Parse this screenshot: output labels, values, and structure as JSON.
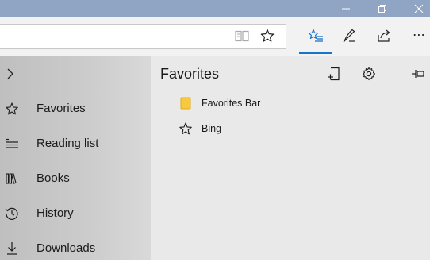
{
  "window": {
    "minimize_label": "Minimize",
    "restore_label": "Restore",
    "close_label": "Close"
  },
  "toolbar": {
    "address_value": "",
    "reading_view_icon": "book-open-icon",
    "add_favorite_icon": "star-outline-icon",
    "hub_icon": "favorites-hub-icon",
    "notes_icon": "pen-icon",
    "share_icon": "share-icon",
    "more_label": "⋯",
    "accent": "#1a73c8"
  },
  "hub": {
    "toggle_icon": "chevron-right-icon",
    "items": [
      {
        "label": "Favorites",
        "icon": "star-outline-icon"
      },
      {
        "label": "Reading list",
        "icon": "reading-list-icon"
      },
      {
        "label": "Books",
        "icon": "books-icon"
      },
      {
        "label": "History",
        "icon": "history-icon"
      },
      {
        "label": "Downloads",
        "icon": "download-icon"
      }
    ]
  },
  "favorites": {
    "title": "Favorites",
    "items": [
      {
        "label": "Favorites Bar",
        "icon": "folder-icon"
      },
      {
        "label": "Bing",
        "icon": "star-outline-icon"
      }
    ],
    "folder_color": "#f8c93c"
  }
}
